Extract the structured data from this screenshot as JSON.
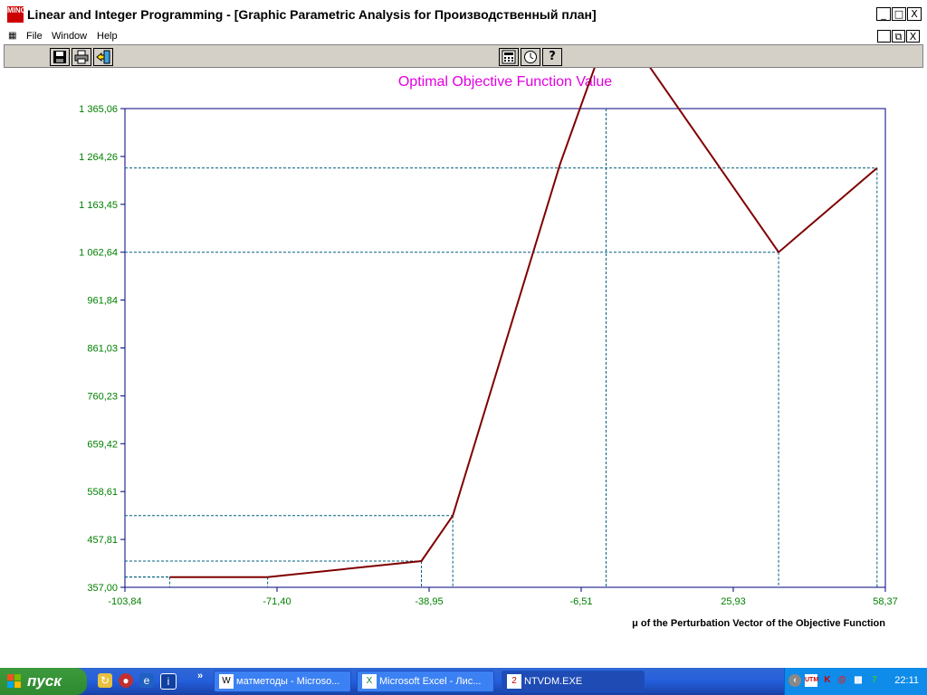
{
  "window": {
    "icon_label": "MINC",
    "title": "Linear and Integer Programming - [Graphic Parametric Analysis for Производственный план]",
    "controls": {
      "minimize": "_",
      "maximize": "□",
      "close": "X"
    },
    "child_controls": {
      "minimize": "_",
      "restore": "⧉",
      "close": "X"
    }
  },
  "menu": {
    "items": [
      "File",
      "Window",
      "Help"
    ]
  },
  "toolbar": {
    "left_buttons": [
      "save-icon",
      "print-icon",
      "exit-icon"
    ],
    "right_buttons": [
      "calculator-icon",
      "clock-icon",
      "help-icon"
    ],
    "help_glyph": "?"
  },
  "chart_data": {
    "type": "line",
    "title": "Optimal Objective Function Value",
    "xlabel": "μ of the Perturbation Vector of the Objective Function",
    "ylabel": "",
    "xlim": [
      -103.84,
      58.37
    ],
    "ylim": [
      357.0,
      1365.06
    ],
    "x_ticks": [
      "-103,84",
      "-71,40",
      "-38,95",
      "-6,51",
      "25,93",
      "58,37"
    ],
    "y_ticks": [
      "357,00",
      "457,81",
      "558,61",
      "659,42",
      "760,23",
      "861,03",
      "961,84",
      "1 062,64",
      "1 163,45",
      "1 264,26",
      "1 365,06"
    ],
    "series": [
      {
        "x": [
          -94.3,
          -73.4,
          -40.6,
          -33.9,
          -11.0,
          -2.0,
          5.0,
          35.6,
          56.6
        ],
        "y": [
          378.6,
          378.6,
          412.3,
          508.0,
          1249.0,
          1497.0,
          1497.0,
          1062.64,
          1240.0
        ]
      }
    ],
    "guides": [
      {
        "x": -94.3,
        "y": 378.6
      },
      {
        "x": -73.4,
        "y": 378.6
      },
      {
        "x": -40.6,
        "y": 412.3
      },
      {
        "x": -33.9,
        "y": 508.0
      },
      {
        "x": -1.2,
        "y": null
      },
      {
        "x": 35.6,
        "y": 1062.64
      },
      {
        "x": 56.6,
        "y": 1240.0
      }
    ],
    "colors": {
      "line": "#800000",
      "guide": "#006080",
      "tick_text": "#008000",
      "title": "#e000e0",
      "frame": "#00007f"
    },
    "grid": false
  },
  "taskbar": {
    "start_label": "пуск",
    "quick_launch": [
      "explorer-icon",
      "media-icon",
      "ie-icon",
      "info-icon"
    ],
    "more": "»",
    "tasks": [
      {
        "label": "матметоды - Microsо...",
        "icon": "W"
      },
      {
        "label": "Microsoft Excel - Лис...",
        "icon": "X"
      },
      {
        "label": "NTVDM.EXE",
        "icon": "2"
      }
    ],
    "tray_icons": [
      "back-icon",
      "utm-icon",
      "kaspersky-icon",
      "mail-icon",
      "network-icon",
      "app-icon"
    ],
    "clock": "22:11"
  }
}
